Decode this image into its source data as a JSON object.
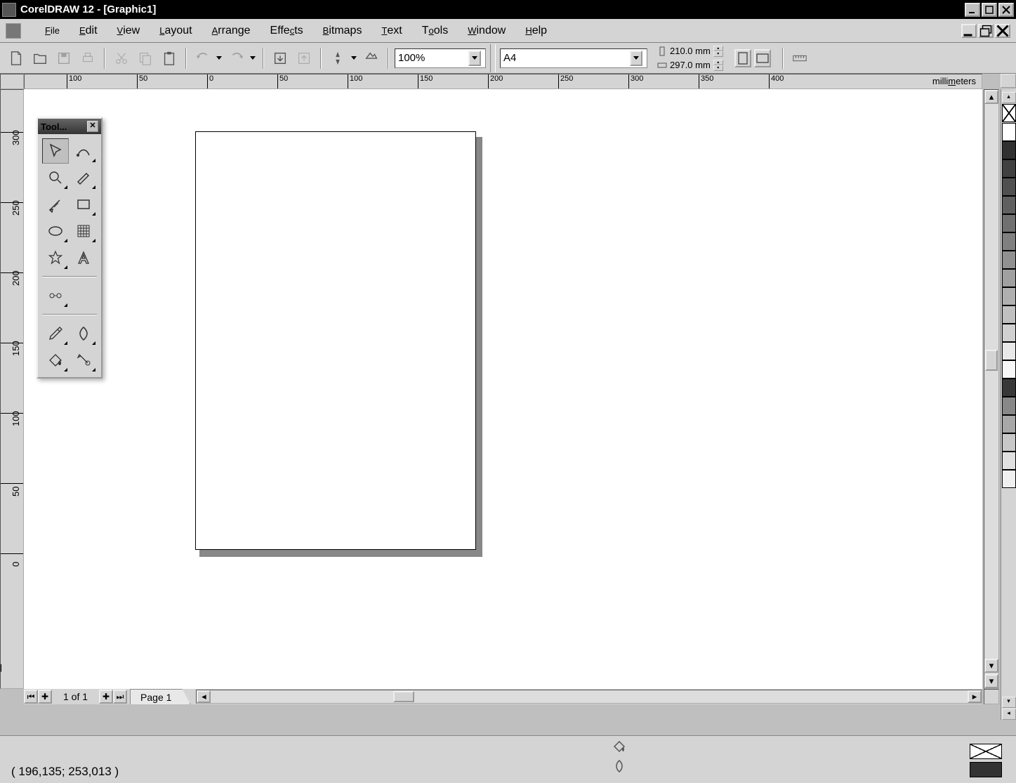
{
  "title": "CorelDRAW 12 - [Graphic1]",
  "menu": [
    "File",
    "Edit",
    "View",
    "Layout",
    "Arrange",
    "Effects",
    "Bitmaps",
    "Text",
    "Tools",
    "Window",
    "Help"
  ],
  "menu_ul": [
    "F",
    "E",
    "V",
    "L",
    "A",
    "E",
    "B",
    "T",
    "T",
    "W",
    "H"
  ],
  "zoom": "100%",
  "paper": "A4",
  "page_width": "210.0 mm",
  "page_height": "297.0 mm",
  "ruler_unit": "millimeters",
  "hruler_ticks": [
    {
      "label": "100",
      "pos": 60
    },
    {
      "label": "50",
      "pos": 160
    },
    {
      "label": "0",
      "pos": 260
    },
    {
      "label": "50",
      "pos": 360
    },
    {
      "label": "100",
      "pos": 460
    },
    {
      "label": "150",
      "pos": 560
    },
    {
      "label": "200",
      "pos": 660
    },
    {
      "label": "250",
      "pos": 760
    },
    {
      "label": "300",
      "pos": 860
    },
    {
      "label": "350",
      "pos": 960
    },
    {
      "label": "400",
      "pos": 1060
    }
  ],
  "vruler_ticks": [
    {
      "label": "300",
      "pos": 60
    },
    {
      "label": "250",
      "pos": 160
    },
    {
      "label": "200",
      "pos": 260
    },
    {
      "label": "150",
      "pos": 360
    },
    {
      "label": "100",
      "pos": 460
    },
    {
      "label": "50",
      "pos": 560
    },
    {
      "label": "0",
      "pos": 660
    }
  ],
  "toolbox_title": "Tool...",
  "page_counter": "1 of 1",
  "page_tab": "Page 1",
  "status_coords": "( 196,135; 253,013 )",
  "palette": [
    "#ffffff",
    "#303030",
    "#404040",
    "#505050",
    "#606060",
    "#707070",
    "#808080",
    "#909090",
    "#a0a0a0",
    "#b0b0b0",
    "#c0c0c0",
    "#d0d0d0",
    "#e8e8e8",
    "#f8f8f8",
    "#383838",
    "#888888",
    "#a8a8a8",
    "#c8c8c8",
    "#e0e0e0",
    "#f0f0f0"
  ]
}
